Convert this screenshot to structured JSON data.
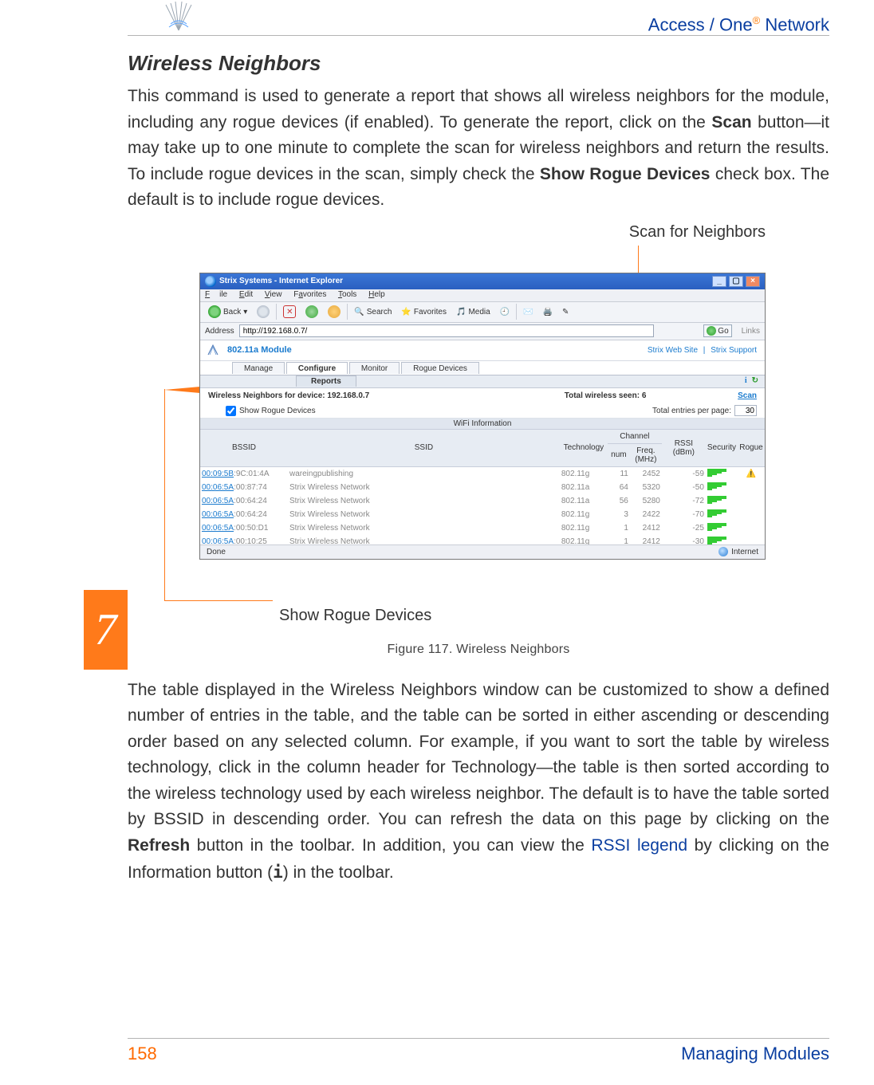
{
  "header": {
    "brand_prefix": "Access / One",
    "brand_suffix": " Network",
    "reg_mark": "®"
  },
  "section_title": "Wireless Neighbors",
  "para1_parts": {
    "t0": "This command is used to generate a report that shows all wireless neighbors for the module, including any rogue devices (if enabled). To generate the report, click on the ",
    "b0": "Scan",
    "t1": " button—it may take up to one minute to complete the scan for wireless neighbors and return the results. To include rogue devices in the scan, simply check the ",
    "b1": "Show Rogue Devices",
    "t2": " check box. The default is to include rogue devices."
  },
  "callouts": {
    "scan": "Scan for Neighbors",
    "rogue": "Show Rogue Devices"
  },
  "figure_caption": "Figure 117. Wireless Neighbors",
  "para2_parts": {
    "t0": "The table displayed in the Wireless Neighbors window can be customized to show a defined number of entries in the table, and the table can be sorted in either ascending or descending order based on any selected column. For example, if you want to sort the table by wireless technology, click in the column header for Technology—the table is then sorted according to the wireless technology used by each wireless neighbor. The default is to have the table sorted by BSSID in descending order. You can refresh the data on this page by clicking on the ",
    "b0": "Refresh",
    "t1": " button in the toolbar. In addition, you can view the ",
    "link": "RSSI legend",
    "t2": " by clicking on the Information button (",
    "mono": "i",
    "t3": ") in the toolbar."
  },
  "chapter_number": "7",
  "footer": {
    "page": "158",
    "section": "Managing Modules"
  },
  "ie": {
    "title": "Strix Systems - Internet Explorer",
    "menu": {
      "file": "File",
      "edit": "Edit",
      "view": "View",
      "fav": "Favorites",
      "tools": "Tools",
      "help": "Help"
    },
    "toolbar": {
      "back": "Back",
      "search": "Search",
      "favorites": "Favorites",
      "media": "Media"
    },
    "address_label": "Address",
    "address_value": "http://192.168.0.7/",
    "go": "Go",
    "links": "Links",
    "module_name": "802.11a Module",
    "top_links": {
      "a": "Strix Web Site",
      "sep": "|",
      "b": "Strix Support"
    },
    "tabs": {
      "manage": "Manage",
      "configure": "Configure",
      "monitor": "Monitor",
      "rogue": "Rogue Devices"
    },
    "subtab": "Reports",
    "tb_info": "i",
    "tb_refresh": "↻",
    "hdr_left": "Wireless Neighbors for device: 192.168.0.7",
    "hdr_mid": "Total wireless seen: 6",
    "scan_link": "Scan",
    "show_rogue": "Show Rogue Devices",
    "entries_label": "Total entries per page:",
    "entries_value": "30",
    "band": "WiFi Information",
    "cols": {
      "bssid": "BSSID",
      "ssid": "SSID",
      "tech": "Technology",
      "chan": "Channel",
      "chan_num": "num",
      "chan_freq": "Freq. (MHz)",
      "rssi": "RSSI (dBm)",
      "sec": "Security",
      "rogue": "Rogue"
    },
    "rows": [
      {
        "mac": "00:09:5B",
        "suf": ":9C:01:4A",
        "ssid": "wareingpublishing",
        "tech": "802.11g",
        "num": "11",
        "freq": "2452",
        "rssi": "-59",
        "rogue": true
      },
      {
        "mac": "00:06:5A",
        "suf": ":00:87:74",
        "ssid": "Strix Wireless Network",
        "tech": "802.11a",
        "num": "64",
        "freq": "5320",
        "rssi": "-50"
      },
      {
        "mac": "00:06:5A",
        "suf": ":00:64:24",
        "ssid": "Strix Wireless Network",
        "tech": "802.11a",
        "num": "56",
        "freq": "5280",
        "rssi": "-72"
      },
      {
        "mac": "00:06:5A",
        "suf": ":00:64:24",
        "ssid": "Strix Wireless Network",
        "tech": "802.11g",
        "num": "3",
        "freq": "2422",
        "rssi": "-70"
      },
      {
        "mac": "00:06:5A",
        "suf": ":00:50:D1",
        "ssid": "Strix Wireless Network",
        "tech": "802.11g",
        "num": "1",
        "freq": "2412",
        "rssi": "-25"
      },
      {
        "mac": "00:06:5A",
        "suf": ":00:10:25",
        "ssid": "Strix Wireless Network",
        "tech": "802.11g",
        "num": "1",
        "freq": "2412",
        "rssi": "-30"
      }
    ],
    "status_left": "Done",
    "status_zone": "Internet"
  }
}
